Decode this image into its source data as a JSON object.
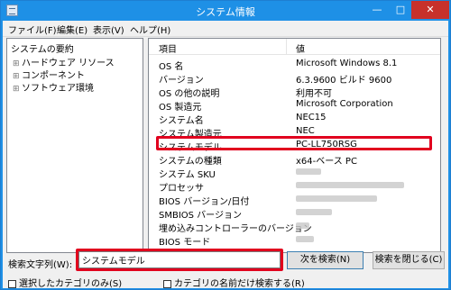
{
  "window": {
    "title": "システム情報",
    "minimize_glyph": "—",
    "maximize_glyph": "□",
    "close_glyph": "✕"
  },
  "menu": [
    "ファイル(F)",
    "編集(E)",
    "表示(V)",
    "ヘルプ(H)"
  ],
  "tree": {
    "root": "システムの要約",
    "children": [
      "ハードウェア リソース",
      "コンポーネント",
      "ソフトウェア環境"
    ],
    "expander_glyph": "⊞"
  },
  "list": {
    "columns": [
      "項目",
      "値"
    ],
    "rows": [
      {
        "item": "OS 名",
        "value": "Microsoft Windows 8.1"
      },
      {
        "item": "バージョン",
        "value": "6.3.9600 ビルド 9600"
      },
      {
        "item": "OS の他の説明",
        "value": "利用不可"
      },
      {
        "item": "OS 製造元",
        "value": "Microsoft Corporation"
      },
      {
        "item": "システム名",
        "value": "NEC15"
      },
      {
        "item": "システム製造元",
        "value": "NEC"
      },
      {
        "item": "システムモデル",
        "value": "PC-LL750RSG",
        "highlighted": true
      },
      {
        "item": "システムの種類",
        "value": "x64-ベース PC"
      },
      {
        "item": "システム SKU",
        "value": "",
        "obscured": true
      },
      {
        "item": "プロセッサ",
        "value": "",
        "obscured": true
      },
      {
        "item": "BIOS バージョン/日付",
        "value": "",
        "obscured": true
      },
      {
        "item": "SMBIOS バージョン",
        "value": "",
        "obscured": true
      },
      {
        "item": "埋め込みコントローラーのバージョン",
        "value": "",
        "obscured": true
      },
      {
        "item": "BIOS モード",
        "value": "",
        "obscured": true
      }
    ]
  },
  "search": {
    "label": "検索文字列(W):",
    "value": "システムモデル",
    "next_button": "次を検索(N)",
    "close_button": "検索を閉じる(C)",
    "checkbox_selected_category": "選択したカテゴリのみ(S)",
    "checkbox_category_names": "カテゴリの名前だけ検索する(R)"
  },
  "colors": {
    "titlebar": "#1e90e6",
    "highlight_frame": "#e1001e",
    "close_button": "#c7312b"
  }
}
